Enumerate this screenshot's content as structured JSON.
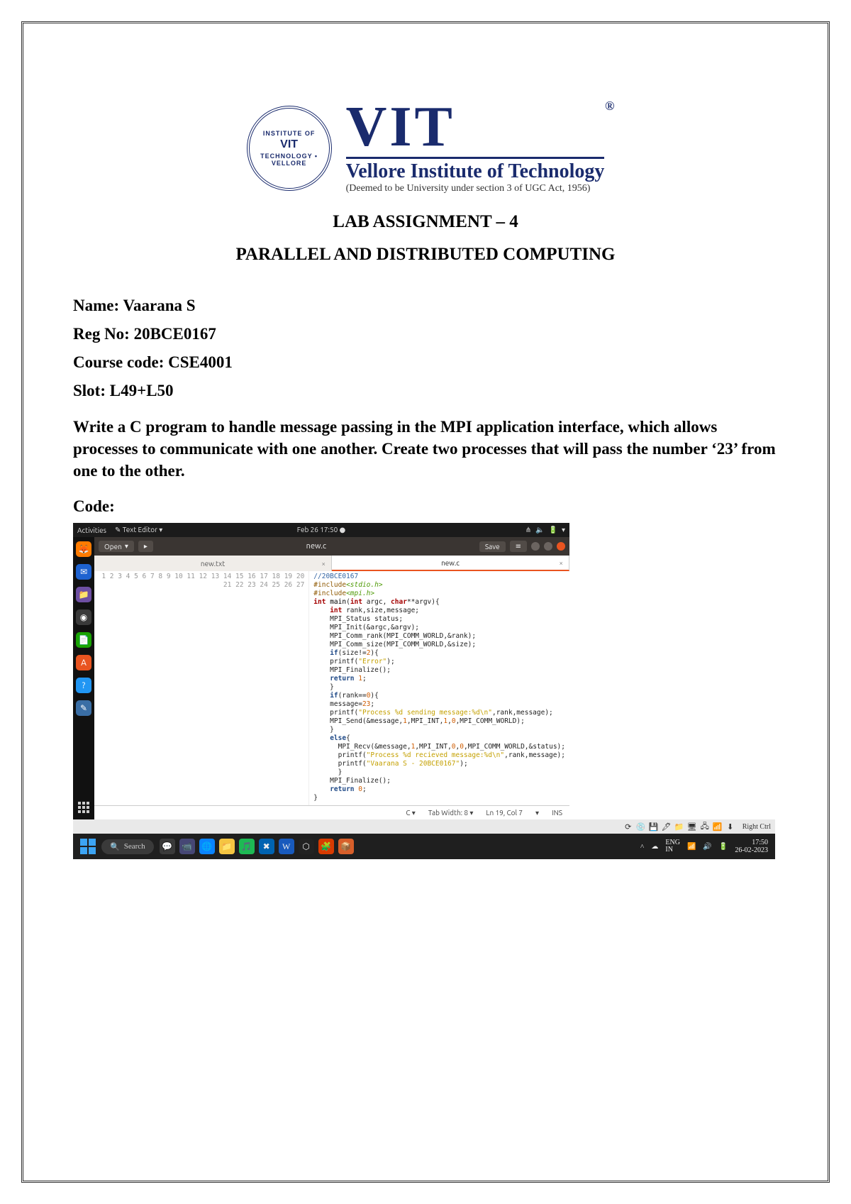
{
  "header": {
    "seal_arc_top": "INSTITUTE OF",
    "seal_mid": "VIT",
    "seal_arc_bot": "TECHNOLOGY • VELLORE",
    "big": "VIT",
    "sub1": "Vellore Institute of Technology",
    "sub2": "(Deemed to be University under section 3 of UGC Act, 1956)"
  },
  "doc": {
    "h1": "LAB ASSIGNMENT – 4",
    "h2": "PARALLEL AND DISTRIBUTED COMPUTING",
    "fields": {
      "name_label": "Name: ",
      "name_value": "Vaarana S",
      "reg_label": "Reg No: ",
      "reg_value": "20BCE0167",
      "course_label": "Course code: ",
      "course_value": "CSE4001",
      "slot_label": "Slot: ",
      "slot_value": "L49+L50"
    },
    "prompt": "Write a C program to handle message passing in the MPI application interface, which allows processes to communicate with one another. Create two processes that will pass the number ‘23’ from one to the other.",
    "code_label": "Code:"
  },
  "ubuntu_topbar": {
    "activities": "Activities",
    "appmenu": "Text Editor ▾",
    "clock": "Feb 26  17:50 ●",
    "icons": [
      "⋔",
      "🔈",
      "🔋",
      "▾"
    ]
  },
  "gedit": {
    "open": "Open",
    "new_tab_icon": "▸",
    "title": "new.c",
    "save": "Save",
    "tabs": [
      {
        "label": "new.txt",
        "active": false
      },
      {
        "label": "new.c",
        "active": true
      }
    ],
    "status": {
      "lang": "C ▾",
      "tab": "Tab Width: 8 ▾",
      "pos": "Ln 19, Col 7",
      "ins_dd": "▾",
      "ins": "INS"
    }
  },
  "code_lines": [
    {
      "n": 1,
      "html": "<span class='c-cmt'>//20BCE0167</span>"
    },
    {
      "n": 2,
      "html": "<span class='c-pre'>#include</span><span class='c-inc'>&lt;stdio.h&gt;</span>"
    },
    {
      "n": 3,
      "html": "<span class='c-pre'>#include</span><span class='c-inc'>&lt;mpi.h&gt;</span>"
    },
    {
      "n": 4,
      "html": "<span class='c-type'>int</span> <span class='c-fn'>main</span>(<span class='c-type'>int</span> argc, <span class='c-type'>char</span>**argv){"
    },
    {
      "n": 5,
      "html": "    <span class='c-type'>int</span> rank,size,message;"
    },
    {
      "n": 6,
      "html": "    MPI_Status status;"
    },
    {
      "n": 7,
      "html": "    MPI_Init(&amp;argc,&amp;argv);"
    },
    {
      "n": 8,
      "html": "    MPI_Comm_rank(MPI_COMM_WORLD,&amp;rank);"
    },
    {
      "n": 9,
      "html": "    MPI_Comm_size(MPI_COMM_WORLD,&amp;size);"
    },
    {
      "n": 10,
      "html": "    <span class='c-kw'>if</span>(size!=<span class='c-num'>2</span>){"
    },
    {
      "n": 11,
      "html": "    printf(<span class='c-str'>\"Error\"</span>);"
    },
    {
      "n": 12,
      "html": "    MPI_Finalize();"
    },
    {
      "n": 13,
      "html": "    <span class='c-kw'>return</span> <span class='c-num'>1</span>;"
    },
    {
      "n": 14,
      "html": "    }"
    },
    {
      "n": 15,
      "html": "    <span class='c-kw'>if</span>(rank==<span class='c-num'>0</span>){"
    },
    {
      "n": 16,
      "html": "    message=<span class='c-num'>23</span>;"
    },
    {
      "n": 17,
      "html": "    printf(<span class='c-str'>\"Process %d sending message:%d\\n\"</span>,rank,message);"
    },
    {
      "n": 18,
      "html": "    MPI_Send(&amp;message,<span class='c-num'>1</span>,MPI_INT,<span class='c-num'>1</span>,<span class='c-num'>0</span>,MPI_COMM_WORLD);"
    },
    {
      "n": 19,
      "html": "    }"
    },
    {
      "n": 20,
      "html": "    <span class='c-kw'>else</span>{"
    },
    {
      "n": 21,
      "html": "      MPI_Recv(&amp;message,<span class='c-num'>1</span>,MPI_INT,<span class='c-num'>0</span>,<span class='c-num'>0</span>,MPI_COMM_WORLD,&amp;status);"
    },
    {
      "n": 22,
      "html": "      printf(<span class='c-str'>\"Process %d recieved message:%d\\n\"</span>,rank,message);"
    },
    {
      "n": 23,
      "html": "      printf(<span class='c-str'>\"Vaarana S - 20BCE0167\"</span>);"
    },
    {
      "n": 24,
      "html": "      }"
    },
    {
      "n": 25,
      "html": "    MPI_Finalize();"
    },
    {
      "n": 26,
      "html": "    <span class='c-kw'>return</span> <span class='c-num'>0</span>;"
    },
    {
      "n": 27,
      "html": "}"
    }
  ],
  "vm_status": {
    "label": "Right Ctrl",
    "icons": [
      "⟳",
      "💿",
      "💾",
      "🖋",
      "📁",
      "🖥",
      "🖧",
      "📶",
      "⬇"
    ]
  },
  "win_taskbar": {
    "search_placeholder": "Search",
    "apps": [
      {
        "glyph": "💬",
        "bg": "#3a3a3a"
      },
      {
        "glyph": "📹",
        "bg": "#464775"
      },
      {
        "glyph": "🌐",
        "bg": "#0a84ff"
      },
      {
        "glyph": "📁",
        "bg": "#f5c542"
      },
      {
        "glyph": "🎵",
        "bg": "#1db954"
      },
      {
        "glyph": "✖",
        "bg": "#0063b1"
      },
      {
        "glyph": "W",
        "bg": "#185abd"
      },
      {
        "glyph": "⬡",
        "bg": "#222"
      },
      {
        "glyph": "🧩",
        "bg": "#d83b01"
      },
      {
        "glyph": "📦",
        "bg": "#d85f2a"
      }
    ],
    "right": {
      "chev": "˄",
      "cloud": "☁",
      "lang": "ENG\nIN",
      "wifi": "📶",
      "vol": "🔊",
      "bat": "🔋",
      "time": "17:50",
      "date": "26-02-2023"
    }
  }
}
